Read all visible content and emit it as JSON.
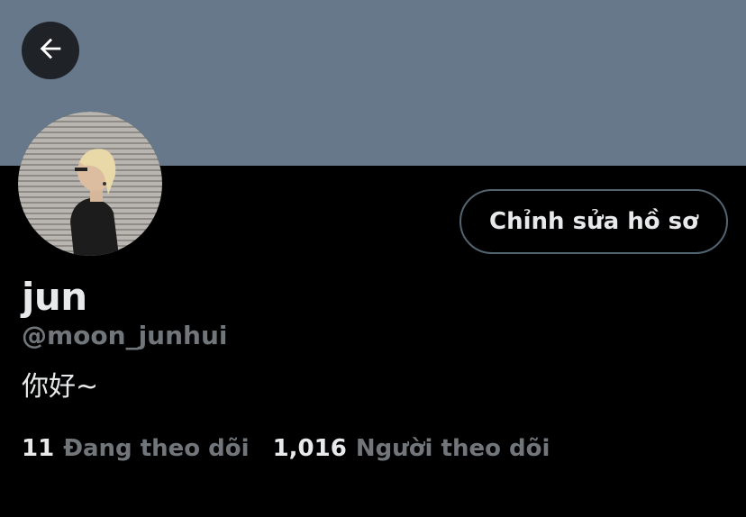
{
  "header": {
    "banner_color": "#66788a",
    "back_icon": "arrow-left-icon"
  },
  "profile": {
    "display_name": "jun",
    "handle": "@moon_junhui",
    "bio": "你好~",
    "edit_button_label": "Chỉnh sửa hồ sơ"
  },
  "stats": {
    "following_count": "11",
    "following_label": "Đang theo dõi",
    "followers_count": "1,016",
    "followers_label": "Người theo dõi"
  },
  "colors": {
    "background": "#000000",
    "text_primary": "#e7e9ea",
    "text_secondary": "#71767b",
    "button_border": "#536471"
  }
}
